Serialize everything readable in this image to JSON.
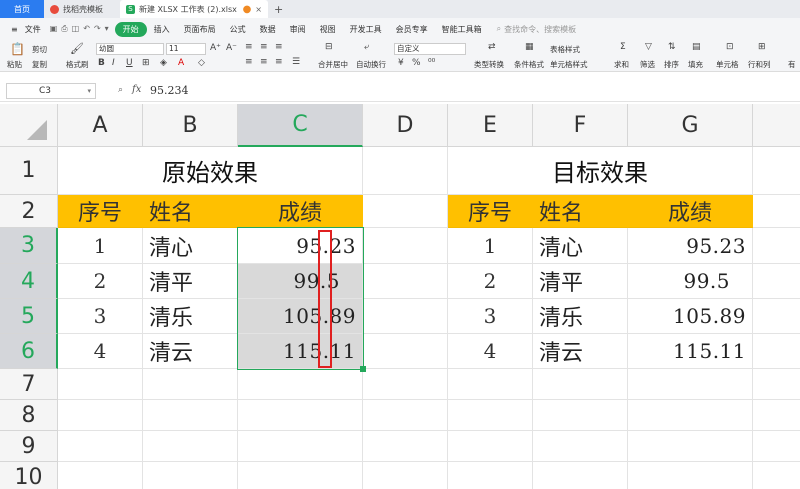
{
  "tabs": [
    {
      "label": "首页"
    },
    {
      "label": "找稻壳模板"
    },
    {
      "label": "新建 XLSX 工作表 (2).xlsx"
    }
  ],
  "menu": {
    "file": "文件",
    "items": [
      "开始",
      "插入",
      "页面布局",
      "公式",
      "数据",
      "审阅",
      "视图",
      "开发工具",
      "会员专享",
      "智能工具箱"
    ],
    "search": "查找命令、搜索模板"
  },
  "ribbon": {
    "paste": "粘贴",
    "cut": "剪切",
    "copy": "复制",
    "format_painter": "格式刷",
    "font_name": "幼圆",
    "font_size": "11",
    "bold": "B",
    "italic": "I",
    "underline": "U",
    "merge_center": "合并居中",
    "wrap_text": "自动换行",
    "number_format": "自定义",
    "currency": "¥",
    "percent": "%",
    "type_convert": "类型转换",
    "conditional_format": "条件格式",
    "table_style": "表格样式",
    "cell_style": "单元格样式",
    "sum": "求和",
    "filter": "筛选",
    "sort": "排序",
    "fill": "填充",
    "cell": "单元格",
    "row_col": "行和列",
    "more": "有"
  },
  "formula_bar": {
    "cell_ref": "C3",
    "fx": "fx",
    "value": "95.234"
  },
  "columns": [
    "A",
    "B",
    "C",
    "D",
    "E",
    "F",
    "G"
  ],
  "rows": [
    "1",
    "2",
    "3",
    "4",
    "5",
    "6",
    "7",
    "8",
    "9",
    "10"
  ],
  "left_table": {
    "title": "原始效果",
    "headers": [
      "序号",
      "姓名",
      "成绩"
    ],
    "rows": [
      {
        "no": "1",
        "name": "清心",
        "score": "95.23"
      },
      {
        "no": "2",
        "name": "清平",
        "score": "99.5"
      },
      {
        "no": "3",
        "name": "清乐",
        "score": "105.89"
      },
      {
        "no": "4",
        "name": "清云",
        "score": "115.11"
      }
    ]
  },
  "right_table": {
    "title": "目标效果",
    "headers": [
      "序号",
      "姓名",
      "成绩"
    ],
    "rows": [
      {
        "no": "1",
        "name": "清心",
        "score": "95.23"
      },
      {
        "no": "2",
        "name": "清平",
        "score": "99.5"
      },
      {
        "no": "3",
        "name": "清乐",
        "score": "105.89"
      },
      {
        "no": "4",
        "name": "清云",
        "score": "115.11"
      }
    ]
  },
  "colors": {
    "accent": "#24a85b",
    "header_fill": "#ffc000",
    "highlight": "#e02020",
    "home_tab": "#2b7cf0"
  }
}
